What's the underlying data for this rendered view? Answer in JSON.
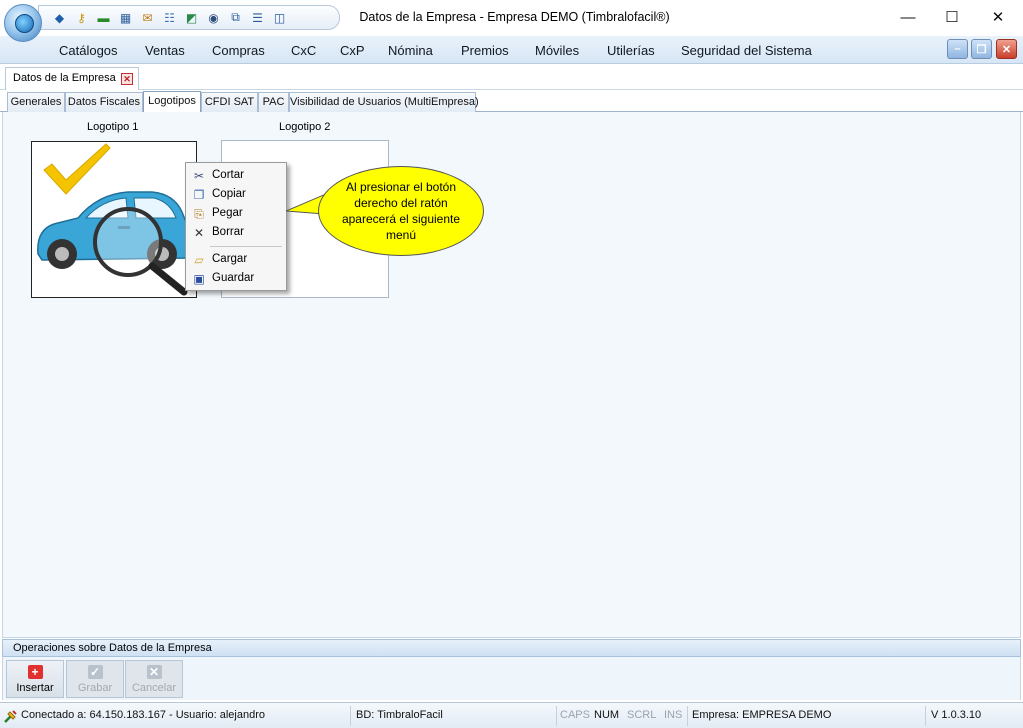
{
  "window": {
    "title": "Datos de la Empresa - Empresa DEMO (Timbralofacil®)",
    "minimize_glyph": "—",
    "maximize_glyph": "☐",
    "close_glyph": "✕"
  },
  "quick_access": [
    {
      "name": "info-icon",
      "glyph": "◆",
      "color": "#1f5fa8"
    },
    {
      "name": "key-icon",
      "glyph": "⚷",
      "color": "#c89a10"
    },
    {
      "name": "money-icon",
      "glyph": "▬",
      "color": "#2a8a2a"
    },
    {
      "name": "calculator-icon",
      "glyph": "▦",
      "color": "#2d5f9a"
    },
    {
      "name": "inbox-icon",
      "glyph": "✉",
      "color": "#c07a10"
    },
    {
      "name": "document-icon",
      "glyph": "☷",
      "color": "#3a6fb0"
    },
    {
      "name": "chart-icon",
      "glyph": "◩",
      "color": "#2a8a4a"
    },
    {
      "name": "eye-icon",
      "glyph": "◉",
      "color": "#2d4f7a"
    },
    {
      "name": "cascade-windows-icon",
      "glyph": "⧉",
      "color": "#2a5a9a"
    },
    {
      "name": "tile-horizontal-icon",
      "glyph": "☰",
      "color": "#2a5a9a"
    },
    {
      "name": "tile-vertical-icon",
      "glyph": "◫",
      "color": "#2a5a9a"
    }
  ],
  "menu": [
    "Catálogos",
    "Ventas",
    "Compras",
    "CxC",
    "CxP",
    "Nómina",
    "Premios",
    "Móviles",
    "Utilerías",
    "Seguridad del Sistema"
  ],
  "mdi_controls": {
    "minimize": "–",
    "restore": "❐",
    "close": "✕"
  },
  "document_tab": {
    "label": "Datos de la Empresa",
    "close_glyph": "✕"
  },
  "tabs": [
    "Generales",
    "Datos Fiscales",
    "Logotipos",
    "CFDI SAT",
    "PAC",
    "Visibilidad de Usuarios (MultiEmpresa)"
  ],
  "active_tab": "Logotipos",
  "logos": {
    "logo1_label": "Logotipo 1",
    "logo2_label": "Logotipo 2"
  },
  "context_menu": [
    {
      "label": "Cortar",
      "icon": "scissors-icon",
      "glyph": "✂",
      "color": "#3a4a7a"
    },
    {
      "label": "Copiar",
      "icon": "copy-icon",
      "glyph": "❐",
      "color": "#3a6fb0"
    },
    {
      "label": "Pegar",
      "icon": "paste-icon",
      "glyph": "⎘",
      "color": "#b0781a"
    },
    {
      "label": "Borrar",
      "icon": "delete-icon",
      "glyph": "✕",
      "color": "#333"
    },
    {
      "label": "Cargar",
      "icon": "folder-open-icon",
      "glyph": "▱",
      "color": "#d1a12a"
    },
    {
      "label": "Guardar",
      "icon": "save-icon",
      "glyph": "▣",
      "color": "#2a4f9a"
    }
  ],
  "callout": {
    "text": "Al presionar el botón derecho del ratón aparecerá el siguiente menú"
  },
  "operations": {
    "header": "Operaciones sobre Datos de la Empresa",
    "buttons": [
      {
        "label": "Insertar",
        "glyph": "+",
        "color": "#e03030",
        "enabled": true
      },
      {
        "label": "Grabar",
        "glyph": "✓",
        "color": "#b8c2cc",
        "enabled": false
      },
      {
        "label": "Cancelar",
        "glyph": "✕",
        "color": "#b8c2cc",
        "enabled": false
      }
    ]
  },
  "status": {
    "connection": "Conectado a: 64.150.183.167 - Usuario: alejandro",
    "database": "BD: TimbraloFacil",
    "caps": "CAPS",
    "num": "NUM",
    "scrl": "SCRL",
    "ins": "INS",
    "company": "Empresa: EMPRESA DEMO",
    "version": "V 1.0.3.10"
  }
}
